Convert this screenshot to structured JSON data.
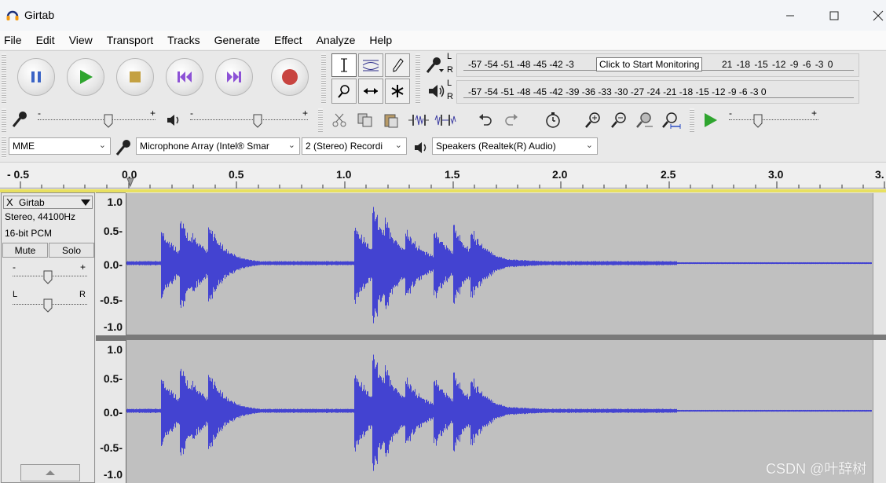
{
  "window": {
    "title": "Girtab"
  },
  "menu": [
    "File",
    "Edit",
    "View",
    "Transport",
    "Tracks",
    "Generate",
    "Effect",
    "Analyze",
    "Help"
  ],
  "transport": {
    "buttons": [
      "pause",
      "play",
      "stop",
      "skip-to-start",
      "skip-to-end",
      "record"
    ]
  },
  "meters": {
    "record_ticks_left": "-57 -54 -51 -48 -45 -42 -3",
    "monitor_tooltip": "Click to Start Monitoring",
    "record_ticks_right": "21 -18 -15 -12  -9  -6  -3  0",
    "record_channel_l": "L",
    "record_channel_r": "R",
    "playback_ticks": "-57 -54 -51 -48 -45 -42 -39 -36 -33 -30 -27 -24 -21 -18 -15 -12  -9  -6  -3  0",
    "playback_channel_l": "L",
    "playback_channel_r": "R"
  },
  "sliders": {
    "mic_minus": "-",
    "mic_plus": "+",
    "spk_minus": "-",
    "spk_plus": "+",
    "play_minus": "-",
    "play_plus": "+"
  },
  "devices": {
    "host": "MME",
    "input": "Microphone Array (Intel® Smar",
    "channels": "2 (Stereo) Recordi",
    "output": "Speakers (Realtek(R) Audio)"
  },
  "ruler": {
    "labels": [
      "- 0.5",
      "0.0",
      "0.5",
      "1.0",
      "1.5",
      "2.0",
      "2.5",
      "3.0",
      "3."
    ]
  },
  "track": {
    "close": "X",
    "name": "Girtab",
    "format_line1": "Stereo, 44100Hz",
    "format_line2": "16-bit PCM",
    "mute": "Mute",
    "solo": "Solo",
    "gain_minus": "-",
    "gain_plus": "+",
    "pan_left": "L",
    "pan_right": "R",
    "scale": [
      "1.0",
      "0.5-",
      "0.0-",
      "-0.5-",
      "-1.0"
    ]
  },
  "watermark": "CSDN @叶辞树",
  "colors": {
    "wave": "#4343d1",
    "wave_bg": "#c0c0c0",
    "accent_yellow": "#e8e060"
  }
}
